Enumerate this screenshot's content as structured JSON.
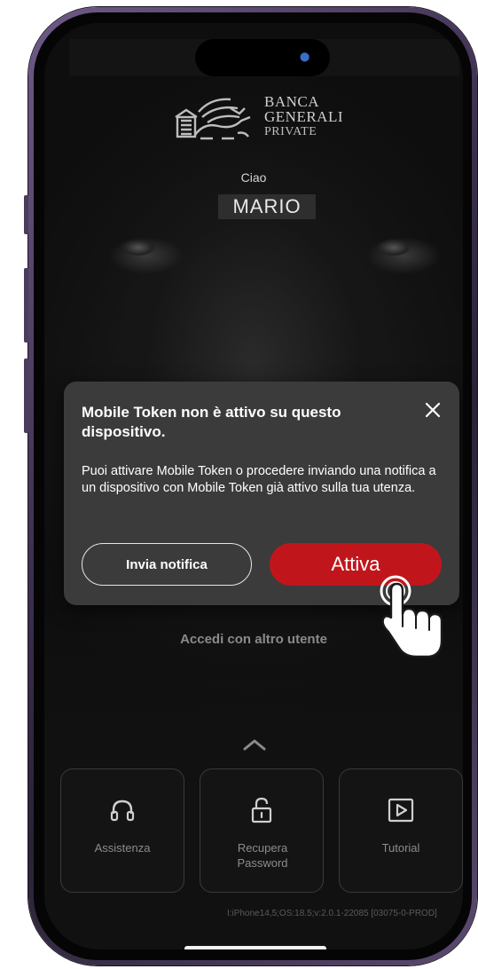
{
  "brand": {
    "line1": "BANCA",
    "line2": "GENERALI",
    "line3": "PRIVATE"
  },
  "greeting": "Ciao",
  "username": "MARIO",
  "modal": {
    "title": "Mobile Token non è attivo su questo dispositivo.",
    "body": "Puoi attivare Mobile Token o procedere inviando una notifica a un dispositivo con Mobile Token già attivo sulla tua utenza.",
    "secondary_label": "Invia notifica",
    "primary_label": "Attiva",
    "close_icon": "close-icon"
  },
  "alt_user_link": "Accedi con altro utente",
  "tiles": [
    {
      "label": "Assistenza",
      "icon": "headset-icon"
    },
    {
      "label": "Recupera Password",
      "icon": "unlock-icon"
    },
    {
      "label": "Tutorial",
      "icon": "play-icon"
    }
  ],
  "device_info": "I:iPhone14,5;OS:18.5;v:2.0.1-22085 [03075-0-PROD]",
  "colors": {
    "accent": "#c0161b",
    "modal_bg": "#3b3b3b",
    "screen_bg": "#111111"
  }
}
